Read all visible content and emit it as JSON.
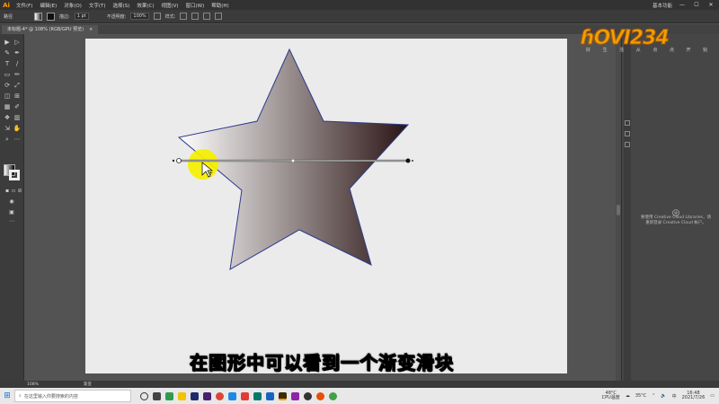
{
  "app": {
    "logo": "Ai"
  },
  "menu": {
    "items": [
      "文件(F)",
      "编辑(E)",
      "对象(O)",
      "文字(T)",
      "选择(S)",
      "效果(C)",
      "视图(V)",
      "窗口(W)",
      "帮助(H)"
    ],
    "workspace": "基本功能",
    "window_buttons": [
      "—",
      "☐",
      "✕"
    ]
  },
  "controlbar": {
    "selection_label": "路径",
    "stroke_label": "描边:",
    "stroke_value": "1 pt",
    "opacity_label": "不透明度:",
    "opacity_value": "100%",
    "style_label": "样式:"
  },
  "document": {
    "tab_title": "未标题-4* @ 108% (RGB/GPU 预览)",
    "close": "×"
  },
  "tools": [
    "▶",
    "▷",
    "✎",
    "✒",
    "T",
    "/",
    "▭",
    "✏",
    "⟳",
    "⤢",
    "◫",
    "⊞",
    "▦",
    "✐",
    "❖",
    "▥",
    "⇲",
    "✋",
    "⌕",
    "⋯"
  ],
  "subtitle": "在图形中可以看到一个渐变滑块",
  "watermark": {
    "logo": "ɦOVI234",
    "sub": "好 生 活 从 点 点 开 始"
  },
  "panel": {
    "cc_line1": "要使用 Creative Cloud Libraries，请",
    "cc_line2": "重新登录 Creative Cloud 帐户。"
  },
  "status": {
    "zoom": "108%",
    "tool_name": "渐变"
  },
  "taskbar": {
    "search_placeholder": "在这里输入你要搜索的内容",
    "weather_temp": "48°C",
    "weather_label": "CPU温度",
    "cpu_temp": "35°C",
    "ime": "中",
    "time": "16:48",
    "date": "2021/7/26"
  },
  "colors": {
    "gradient_start": "#ffffff",
    "gradient_end": "#2a1414",
    "star_stroke": "#2e3a8c",
    "cursor_highlight": "#f5f000"
  }
}
